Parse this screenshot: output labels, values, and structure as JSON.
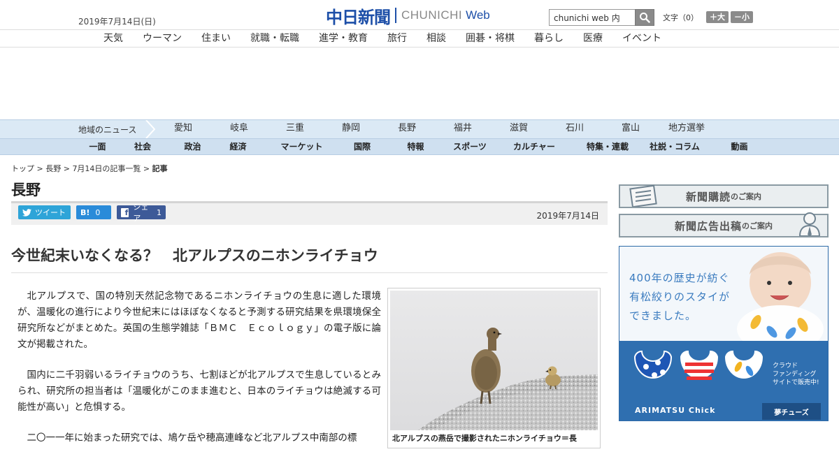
{
  "header": {
    "date": "2019年7月14日(日)",
    "logo_kanji": "中日新聞",
    "logo_latin": "CHUNICHI",
    "logo_web": "Web",
    "search_value": "chunichi web 内",
    "font_size_label": "文字（0）",
    "font_up": "＋大",
    "font_down": "－小"
  },
  "nav_main": [
    "天気",
    "ウーマン",
    "住まい",
    "就職・転職",
    "進学・教育",
    "旅行",
    "相談",
    "囲碁・将棋",
    "暮らし",
    "医療",
    "イベント"
  ],
  "nav_region": {
    "label": "地域のニュース",
    "items": [
      "愛知",
      "岐阜",
      "三重",
      "静岡",
      "長野",
      "福井",
      "滋賀",
      "石川",
      "富山",
      "地方選挙"
    ]
  },
  "nav_section": [
    "一面",
    "社会",
    "政治",
    "経済",
    "マーケット",
    "国際",
    "特報",
    "スポーツ",
    "カルチャー",
    "特集・連載",
    "社説・コラム",
    "動画"
  ],
  "breadcrumb": {
    "items": [
      "トップ",
      "長野",
      "7月14日の記事一覧"
    ],
    "current": "記事"
  },
  "section_title": "長野",
  "share": {
    "tweet": "ツイート",
    "hatena_count": "0",
    "facebook": "シェア",
    "facebook_count": "1",
    "date": "2019年7月14日"
  },
  "article": {
    "headline": "今世紀末いなくなる？　北アルプスのニホンライチョウ",
    "paragraphs": [
      "北アルプスで、国の特別天然記念物であるニホンライチョウの生息に適した環境が、温暖化の進行により今世紀末にはほぼなくなると予測する研究結果を県環境保全研究所などがまとめた。英国の生態学雑誌「ＢＭＣ　Ｅｃｏｌｏｇｙ」の電子版に論文が掲載された。",
      "国内に二千羽弱いるライチョウのうち、七割ほどが北アルプスで生息しているとみられ、研究所の担当者は「温暖化がこのまま進むと、日本のライチョウは絶滅する可能性が高い」と危惧する。",
      "二〇一一年に始まった研究では、鳩ケ岳や穂高連峰など北アルプス中南部の標"
    ],
    "photo_caption": "北アルプスの燕岳で撮影されたニホンライチョウ＝長"
  },
  "sidebar": {
    "subscribe_main": "新聞購読",
    "subscribe_sub": "のご案内",
    "ad_main": "新聞広告出稿",
    "ad_sub": "のご案内",
    "banner_lines": [
      "400年の歴史が紡ぐ",
      "有松絞りのスタイが",
      "できました。"
    ],
    "banner_cf": [
      "クラウド",
      "ファンディング",
      "サイトで販売中!"
    ],
    "banner_brand": "ARIMATSU Chick",
    "banner_brand2": "夢チューズ"
  }
}
